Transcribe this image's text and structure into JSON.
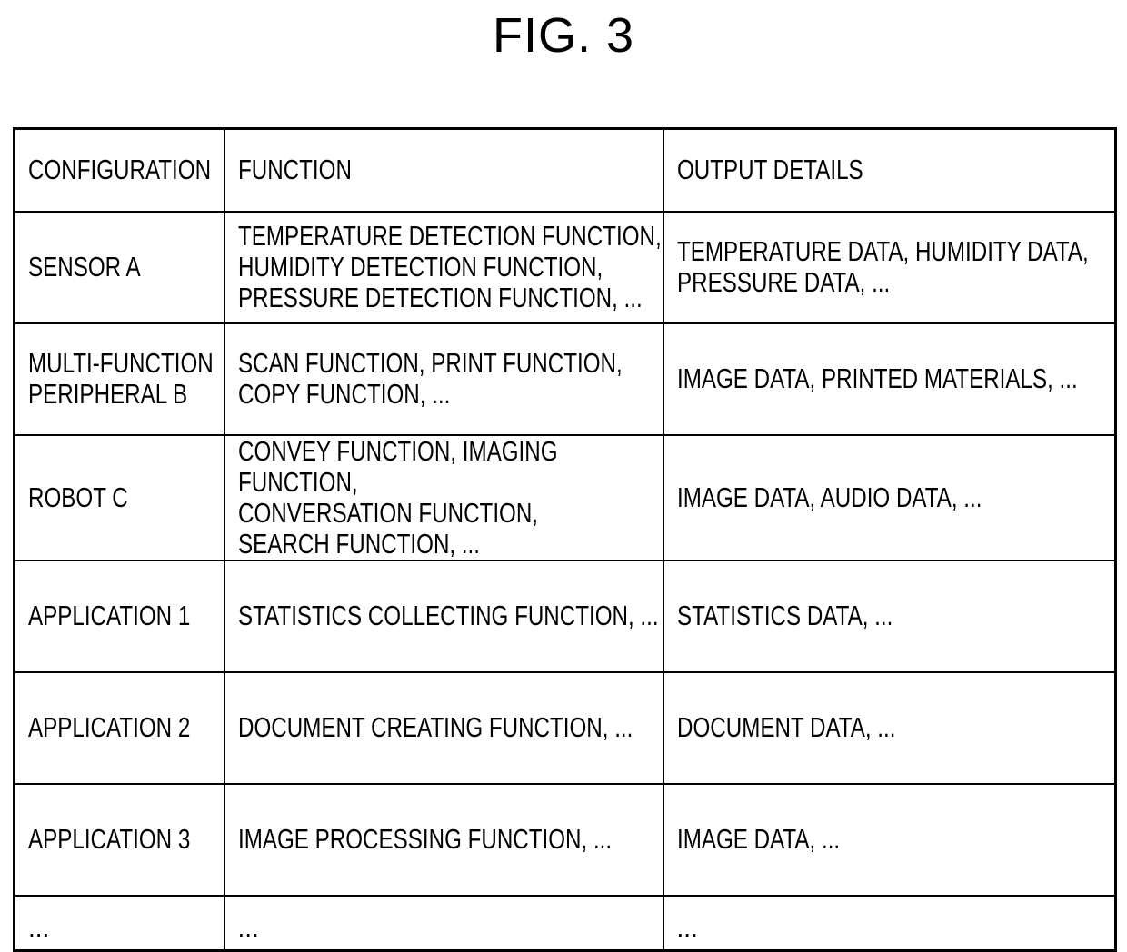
{
  "figure": {
    "title": "FIG. 3"
  },
  "table": {
    "headers": [
      "CONFIGURATION",
      "FUNCTION",
      "OUTPUT DETAILS"
    ],
    "rows": [
      {
        "configuration": "SENSOR A",
        "function": "TEMPERATURE DETECTION FUNCTION,\nHUMIDITY DETECTION FUNCTION,\nPRESSURE DETECTION FUNCTION, ...",
        "output": "TEMPERATURE DATA, HUMIDITY DATA,\nPRESSURE DATA, ..."
      },
      {
        "configuration": "MULTI-FUNCTION\nPERIPHERAL B",
        "function": "SCAN FUNCTION, PRINT FUNCTION,\nCOPY FUNCTION, ...",
        "output": "IMAGE DATA, PRINTED MATERIALS, ..."
      },
      {
        "configuration": "ROBOT C",
        "function": "CONVEY FUNCTION, IMAGING FUNCTION,\nCONVERSATION FUNCTION,\nSEARCH FUNCTION, ...",
        "output": "IMAGE DATA, AUDIO DATA, ..."
      },
      {
        "configuration": "APPLICATION 1",
        "function": "STATISTICS COLLECTING FUNCTION, ...",
        "output": "STATISTICS DATA, ..."
      },
      {
        "configuration": "APPLICATION 2",
        "function": "DOCUMENT CREATING FUNCTION, ...",
        "output": "DOCUMENT DATA, ..."
      },
      {
        "configuration": "APPLICATION 3",
        "function": "IMAGE PROCESSING FUNCTION, ...",
        "output": "IMAGE DATA, ..."
      },
      {
        "configuration": "...",
        "function": "...",
        "output": "..."
      }
    ]
  }
}
